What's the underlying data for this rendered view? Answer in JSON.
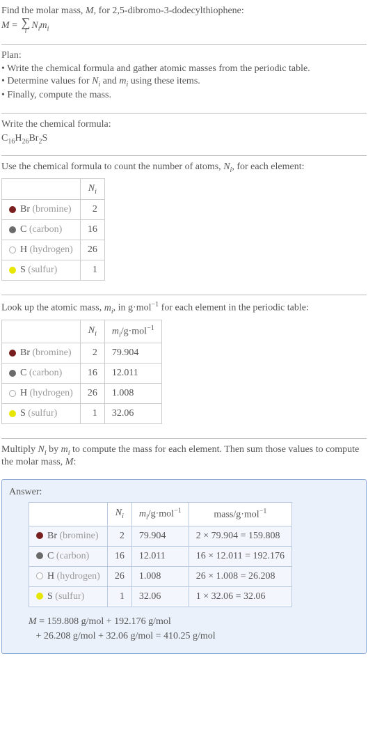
{
  "intro": {
    "line1_pre": "Find the molar mass, ",
    "line1_mid": ", for 2,5-dibromo-3-dodecylthiophene:",
    "M": "M",
    "eq": " = ",
    "sum_under": "i",
    "term": "N_i m_i"
  },
  "plan": {
    "title": "Plan:",
    "b1": "• Write the chemical formula and gather atomic masses from the periodic table.",
    "b2_pre": "• Determine values for ",
    "b2_mid": " and ",
    "b2_post": " using these items.",
    "Ni": "N_i",
    "mi": "m_i",
    "b3": "• Finally, compute the mass."
  },
  "formula": {
    "title": "Write the chemical formula:",
    "C": "C",
    "Cn": "16",
    "H": "H",
    "Hn": "26",
    "Br": "Br",
    "Brn": "2",
    "S": "S"
  },
  "count": {
    "title_pre": "Use the chemical formula to count the number of atoms, ",
    "title_post": ", for each element:",
    "Ni": "N_i",
    "rows": [
      {
        "sym": "Br",
        "name": "(bromine)",
        "n": "2",
        "color": "#7a1f1f",
        "ring": false
      },
      {
        "sym": "C",
        "name": "(carbon)",
        "n": "16",
        "color": "#6b6b6b",
        "ring": false
      },
      {
        "sym": "H",
        "name": "(hydrogen)",
        "n": "26",
        "color": "#ffffff",
        "ring": true
      },
      {
        "sym": "S",
        "name": "(sulfur)",
        "n": "1",
        "color": "#e6e600",
        "ring": false
      }
    ]
  },
  "masses": {
    "title_pre": "Look up the atomic mass, ",
    "title_post": ", in g·mol",
    "title_end": " for each element in the periodic table:",
    "mi": "m_i",
    "hdr_m": "m_i /g·mol",
    "rows": [
      {
        "sym": "Br",
        "name": "(bromine)",
        "n": "2",
        "m": "79.904",
        "color": "#7a1f1f",
        "ring": false
      },
      {
        "sym": "C",
        "name": "(carbon)",
        "n": "16",
        "m": "12.011",
        "color": "#6b6b6b",
        "ring": false
      },
      {
        "sym": "H",
        "name": "(hydrogen)",
        "n": "26",
        "m": "1.008",
        "color": "#ffffff",
        "ring": true
      },
      {
        "sym": "S",
        "name": "(sulfur)",
        "n": "1",
        "m": "32.06",
        "color": "#e6e600",
        "ring": false
      }
    ]
  },
  "multiply": {
    "text_pre": "Multiply ",
    "text_mid": " by ",
    "text_post": " to compute the mass for each element. Then sum those values to compute the molar mass, ",
    "text_end": ":"
  },
  "answer": {
    "label": "Answer:",
    "hdr_mass": "mass/g·mol",
    "rows": [
      {
        "sym": "Br",
        "name": "(bromine)",
        "n": "2",
        "m": "79.904",
        "calc": "2 × 79.904 = 159.808",
        "color": "#7a1f1f",
        "ring": false
      },
      {
        "sym": "C",
        "name": "(carbon)",
        "n": "16",
        "m": "12.011",
        "calc": "16 × 12.011 = 192.176",
        "color": "#6b6b6b",
        "ring": false
      },
      {
        "sym": "H",
        "name": "(hydrogen)",
        "n": "26",
        "m": "1.008",
        "calc": "26 × 1.008 = 26.208",
        "color": "#ffffff",
        "ring": true
      },
      {
        "sym": "S",
        "name": "(sulfur)",
        "n": "1",
        "m": "32.06",
        "calc": "1 × 32.06 = 32.06",
        "color": "#e6e600",
        "ring": false
      }
    ],
    "final_l1": "M = 159.808 g/mol + 192.176 g/mol",
    "final_l2": "+ 26.208 g/mol + 32.06 g/mol = 410.25 g/mol"
  }
}
